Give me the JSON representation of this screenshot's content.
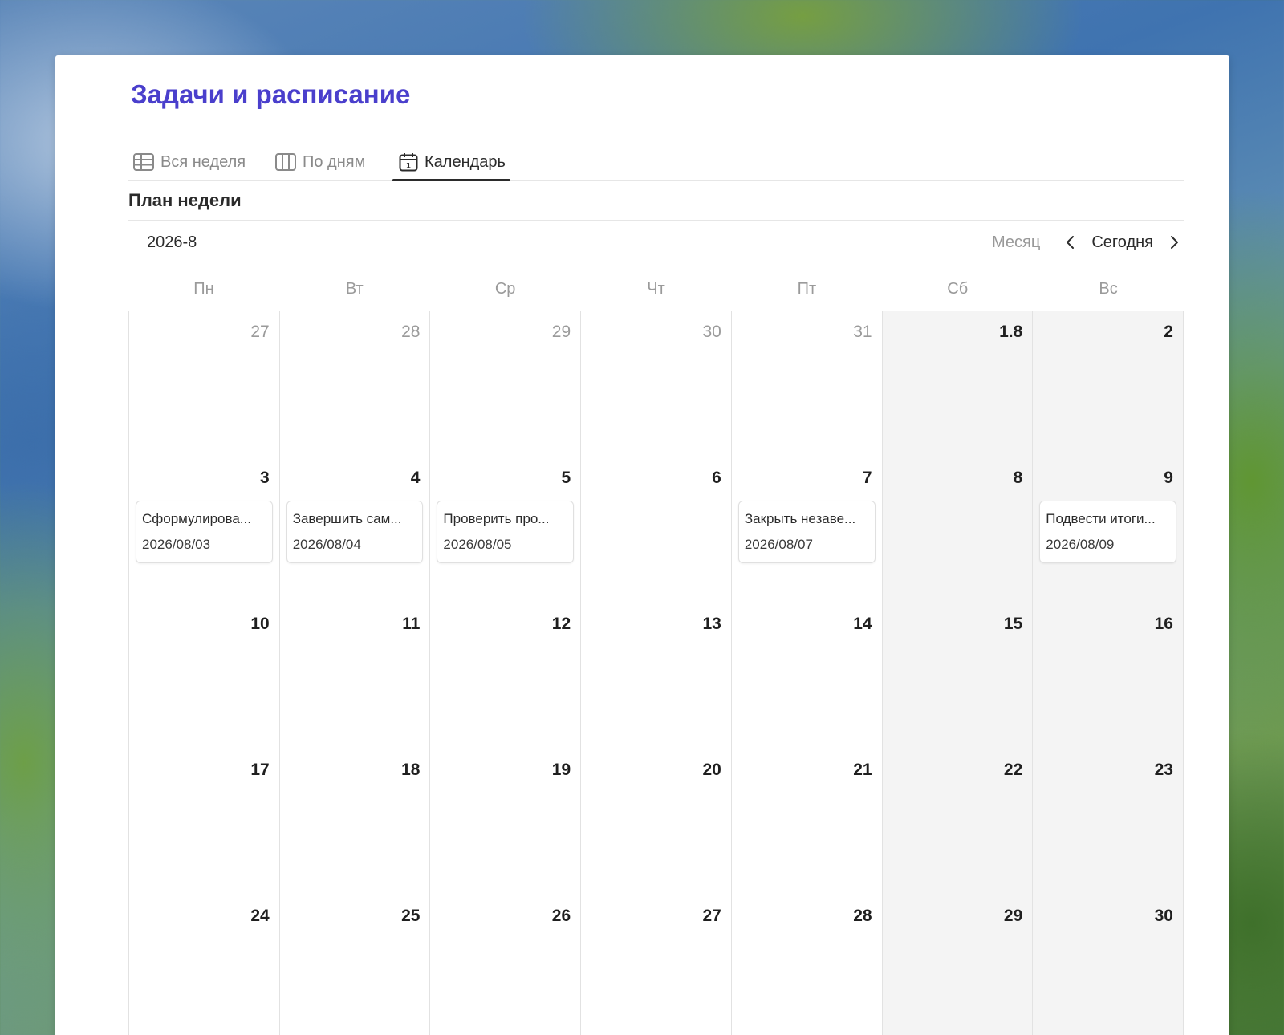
{
  "page": {
    "title": "Задачи и расписание"
  },
  "tabs": [
    {
      "label": "Вся неделя",
      "icon": "table-icon",
      "active": false
    },
    {
      "label": "По дням",
      "icon": "board-columns-icon",
      "active": false
    },
    {
      "label": "Календарь",
      "icon": "calendar-icon",
      "active": true
    }
  ],
  "view": {
    "title": "План недели"
  },
  "calendar": {
    "month_label": "2026-8",
    "mode_label": "Месяц",
    "today_label": "Сегодня",
    "weekdays": [
      "Пн",
      "Вт",
      "Ср",
      "Чт",
      "Пт",
      "Сб",
      "Вс"
    ],
    "weeks": [
      [
        {
          "label": "27",
          "other": true,
          "weekend": false
        },
        {
          "label": "28",
          "other": true,
          "weekend": false
        },
        {
          "label": "29",
          "other": true,
          "weekend": false
        },
        {
          "label": "30",
          "other": true,
          "weekend": false
        },
        {
          "label": "31",
          "other": true,
          "weekend": false
        },
        {
          "label": "1.8",
          "other": false,
          "weekend": true
        },
        {
          "label": "2",
          "other": false,
          "weekend": true
        }
      ],
      [
        {
          "label": "3",
          "other": false,
          "weekend": false,
          "event": {
            "title": "Сформулирова...",
            "date": "2026/08/03"
          }
        },
        {
          "label": "4",
          "other": false,
          "weekend": false,
          "event": {
            "title": "Завершить сам...",
            "date": "2026/08/04"
          }
        },
        {
          "label": "5",
          "other": false,
          "weekend": false,
          "event": {
            "title": "Проверить про...",
            "date": "2026/08/05"
          }
        },
        {
          "label": "6",
          "other": false,
          "weekend": false
        },
        {
          "label": "7",
          "other": false,
          "weekend": false,
          "event": {
            "title": "Закрыть незаве...",
            "date": "2026/08/07"
          }
        },
        {
          "label": "8",
          "other": false,
          "weekend": true
        },
        {
          "label": "9",
          "other": false,
          "weekend": true,
          "event": {
            "title": "Подвести итоги...",
            "date": "2026/08/09"
          }
        }
      ],
      [
        {
          "label": "10",
          "other": false,
          "weekend": false
        },
        {
          "label": "11",
          "other": false,
          "weekend": false
        },
        {
          "label": "12",
          "other": false,
          "weekend": false
        },
        {
          "label": "13",
          "other": false,
          "weekend": false
        },
        {
          "label": "14",
          "other": false,
          "weekend": false
        },
        {
          "label": "15",
          "other": false,
          "weekend": true
        },
        {
          "label": "16",
          "other": false,
          "weekend": true
        }
      ],
      [
        {
          "label": "17",
          "other": false,
          "weekend": false
        },
        {
          "label": "18",
          "other": false,
          "weekend": false
        },
        {
          "label": "19",
          "other": false,
          "weekend": false
        },
        {
          "label": "20",
          "other": false,
          "weekend": false
        },
        {
          "label": "21",
          "other": false,
          "weekend": false
        },
        {
          "label": "22",
          "other": false,
          "weekend": true
        },
        {
          "label": "23",
          "other": false,
          "weekend": true
        }
      ],
      [
        {
          "label": "24",
          "other": false,
          "weekend": false
        },
        {
          "label": "25",
          "other": false,
          "weekend": false
        },
        {
          "label": "26",
          "other": false,
          "weekend": false
        },
        {
          "label": "27",
          "other": false,
          "weekend": false
        },
        {
          "label": "28",
          "other": false,
          "weekend": false
        },
        {
          "label": "29",
          "other": false,
          "weekend": true
        },
        {
          "label": "30",
          "other": false,
          "weekend": true
        }
      ]
    ]
  },
  "colors": {
    "title": "#4a3fcc",
    "weekend_bg": "#f4f4f4",
    "border": "#e2e2e2"
  }
}
